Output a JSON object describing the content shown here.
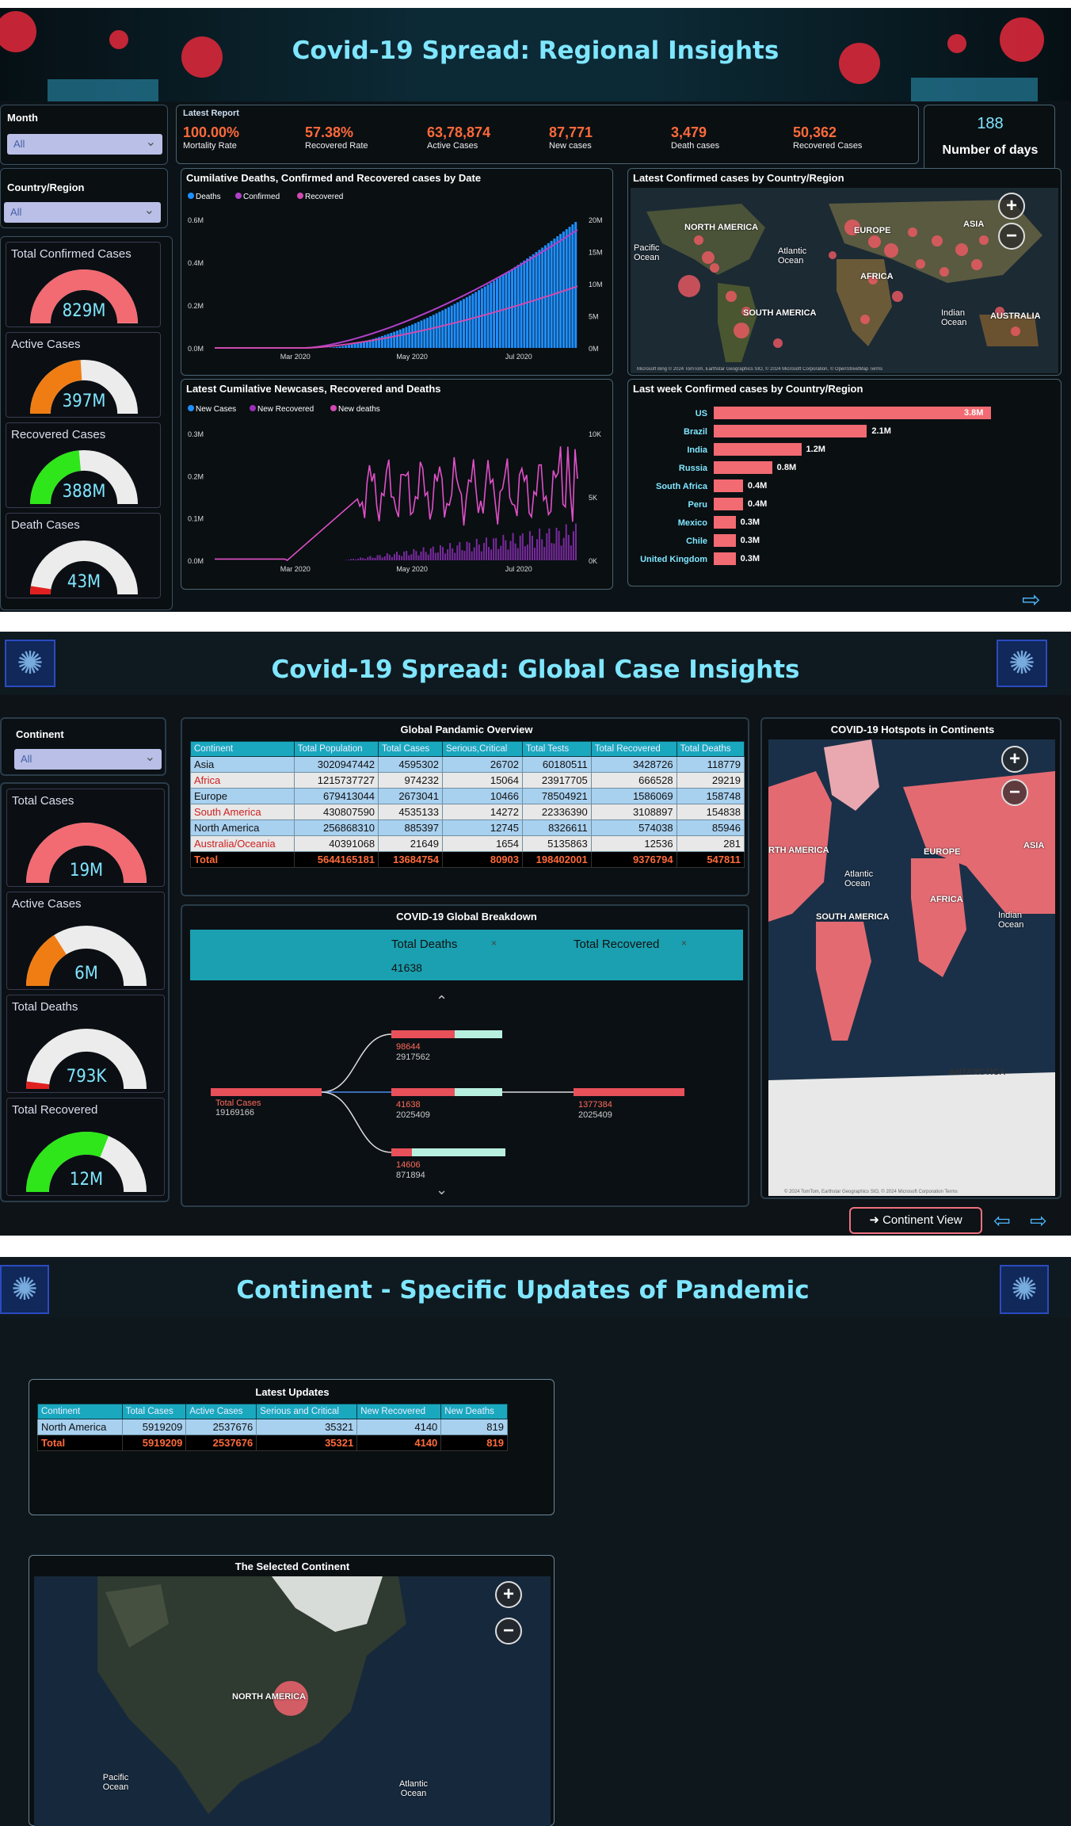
{
  "page1": {
    "title": "Covid-19 Spread: Regional Insights",
    "filters": {
      "month_label": "Month",
      "month_value": "All",
      "country_label": "Country/Region",
      "country_value": "All"
    },
    "latest_report": {
      "label": "Latest Report",
      "kpis": [
        {
          "value": "100.00%",
          "label": "Mortality Rate"
        },
        {
          "value": "57.38%",
          "label": "Recovered Rate"
        },
        {
          "value": "63,78,874",
          "label": "Active Cases"
        },
        {
          "value": "87,771",
          "label": "New cases"
        },
        {
          "value": "3,479",
          "label": "Death cases"
        },
        {
          "value": "50,362",
          "label": "Recovered Cases"
        }
      ]
    },
    "days": {
      "value": "188",
      "label": "Number of days"
    },
    "gauges": [
      {
        "label": "Total Confirmed Cases",
        "value": "829M",
        "fraction": 1.0,
        "color": "#f26a72"
      },
      {
        "label": "Active Cases",
        "value": "397M",
        "fraction": 0.48,
        "color": "#f07d14"
      },
      {
        "label": "Recovered Cases",
        "value": "388M",
        "fraction": 0.47,
        "color": "#2ee61a"
      },
      {
        "label": "Death Cases",
        "value": "43M",
        "fraction": 0.05,
        "color": "#e02020"
      }
    ],
    "cumulative_chart": {
      "title": "Cumilative Deaths, Confirmed and Recovered cases by Date",
      "legend": [
        "Deaths",
        "Confirmed",
        "Recovered"
      ],
      "left_ticks": [
        "0.6M",
        "0.4M",
        "0.2M",
        "0.0M"
      ],
      "right_ticks": [
        "20M",
        "15M",
        "10M",
        "5M",
        "0M"
      ],
      "x_ticks": [
        "Mar 2020",
        "May 2020",
        "Jul 2020"
      ],
      "colors": {
        "deaths": "#1e8fff",
        "confirmed": "#b040c8",
        "recovered": "#d04ab0"
      }
    },
    "newcases_chart": {
      "title": "Latest Cumilative Newcases, Recovered and Deaths",
      "legend": [
        "New Cases",
        "New Recovered",
        "New deaths"
      ],
      "left_ticks": [
        "0.3M",
        "0.2M",
        "0.1M",
        "0.0M"
      ],
      "right_ticks": [
        "10K",
        "5K",
        "0K"
      ],
      "x_ticks": [
        "Mar 2020",
        "May 2020",
        "Jul 2020"
      ]
    },
    "map_latest": {
      "title": "Latest Confirmed cases by Country/Region",
      "labels": [
        "NORTH AMERICA",
        "EUROPE",
        "ASIA",
        "Pacific Ocean",
        "Atlantic Ocean",
        "AFRICA",
        "SOUTH AMERICA",
        "Indian Ocean",
        "AUSTRALIA"
      ],
      "attribution": "Microsoft Bing  © 2024 TomTom, Earthstar Geographics SIO, © 2024 Microsoft Corporation, © OpenStreetMap  Terms"
    },
    "lastweek_chart": {
      "title": "Last week Confirmed cases by Country/Region",
      "chart_data": {
        "type": "bar",
        "categories": [
          "US",
          "Brazil",
          "India",
          "Russia",
          "South Africa",
          "Peru",
          "Mexico",
          "Chile",
          "United Kingdom"
        ],
        "values": [
          3.8,
          2.1,
          1.2,
          0.8,
          0.4,
          0.4,
          0.3,
          0.3,
          0.3
        ],
        "labels": [
          "3.8M",
          "2.1M",
          "1.2M",
          "0.8M",
          "0.4M",
          "0.4M",
          "0.3M",
          "0.3M",
          "0.3M"
        ],
        "color": "#f26a72"
      }
    }
  },
  "page2": {
    "title": "Covid-19 Spread: Global Case Insights",
    "filter": {
      "label": "Continent",
      "value": "All"
    },
    "gauges": [
      {
        "label": "Total Cases",
        "value": "19M",
        "fraction": 1.0,
        "color": "#f26a72"
      },
      {
        "label": "Active Cases",
        "value": "6M",
        "fraction": 0.32,
        "color": "#f07d14"
      },
      {
        "label": "Total Deaths",
        "value": "793K",
        "fraction": 0.04,
        "color": "#e02020"
      },
      {
        "label": "Total Recovered",
        "value": "12M",
        "fraction": 0.62,
        "color": "#2ee61a"
      }
    ],
    "overview": {
      "title": "Global Pandamic Overview",
      "headers": [
        "Continent",
        "Total Population",
        "Total Cases",
        "Serious,Critical",
        "Total Tests",
        "Total Recovered",
        "Total Deaths"
      ],
      "rows": [
        [
          "Asia",
          "3020947442",
          "4595302",
          "26702",
          "60180511",
          "3428726",
          "118779"
        ],
        [
          "Africa",
          "1215737727",
          "974232",
          "15064",
          "23917705",
          "666528",
          "29219"
        ],
        [
          "Europe",
          "679413044",
          "2673041",
          "10466",
          "78504921",
          "1586069",
          "158748"
        ],
        [
          "South America",
          "430807590",
          "4535133",
          "14272",
          "22336390",
          "3108897",
          "154838"
        ],
        [
          "North America",
          "256868310",
          "885397",
          "12745",
          "8326611",
          "574038",
          "85946"
        ],
        [
          "Australia/Oceania",
          "40391068",
          "21649",
          "1654",
          "5135863",
          "12536",
          "281"
        ]
      ],
      "total": [
        "Total",
        "5644165181",
        "13684754",
        "80903",
        "198402001",
        "9376794",
        "547811"
      ]
    },
    "breakdown": {
      "title": "COVID-19 Global Breakdown",
      "col1": "Total Deaths",
      "col2": "Total Recovered",
      "col1_value": "41638",
      "root_label": "Total Cases",
      "root_value": "19169166",
      "nodes": [
        {
          "a": "98644",
          "b": "2917562"
        },
        {
          "a": "41638",
          "b": "2025409"
        },
        {
          "a": "14606",
          "b": "871894"
        }
      ],
      "leaf": {
        "a": "1377384",
        "b": "2025409"
      }
    },
    "hotspots": {
      "title": "COVID-19 Hotspots in Continents",
      "labels": [
        "RTH AMERICA",
        "EUROPE",
        "ASIA",
        "Atlantic Ocean",
        "AFRICA",
        "SOUTH AMERICA",
        "Indian Ocean",
        "ANTARCTICA"
      ],
      "attribution": "© 2024 TomTom, Earthstar Geographics SIO, © 2024 Microsoft Corporation  Terms"
    },
    "nav_button": "Continent View"
  },
  "page3": {
    "title": "Continent - Specific Updates of Pandemic",
    "updates": {
      "title": "Latest Updates",
      "headers": [
        "Continent",
        "Total Cases",
        "Active Cases",
        "Serious and Critical",
        "New Recovered",
        "New Deaths"
      ],
      "row": [
        "North America",
        "5919209",
        "2537676",
        "35321",
        "4140",
        "819"
      ],
      "total": [
        "Total",
        "5919209",
        "2537676",
        "35321",
        "4140",
        "819"
      ]
    },
    "selected_map": {
      "title": "The Selected Continent",
      "labels": [
        "NORTH AMERICA",
        "Pacific Ocean",
        "Atlantic Ocean"
      ]
    }
  }
}
